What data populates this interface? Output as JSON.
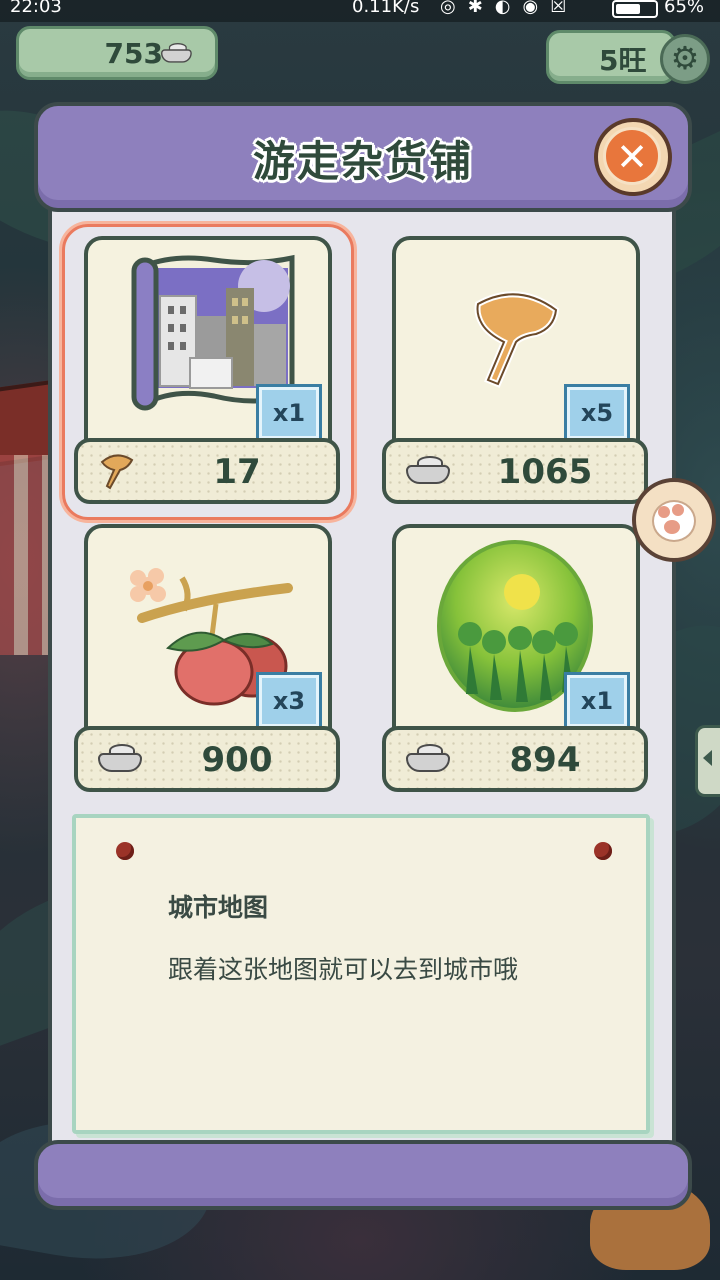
{
  "status_bar": {
    "time": "22:03",
    "network_speed": "0.11K/s",
    "battery": "65%"
  },
  "top_bar": {
    "currency_amount": "753",
    "currency_icon": "silver-ingot-icon",
    "level": "5旺",
    "settings_icon": "gear-icon"
  },
  "shop": {
    "title": "游走杂货铺",
    "close_icon": "close-icon",
    "items": [
      {
        "name": "城市地图",
        "art": "city-map-icon",
        "quantity": "x1",
        "price": "17",
        "price_icon": "ginkgo-leaf-icon",
        "selected": true
      },
      {
        "name": "",
        "art": "ginkgo-leaf-icon",
        "quantity": "x5",
        "price": "1065",
        "price_icon": "silver-ingot-icon",
        "selected": false
      },
      {
        "name": "",
        "art": "fruit-branch-icon",
        "quantity": "x3",
        "price": "900",
        "price_icon": "silver-ingot-icon",
        "selected": false
      },
      {
        "name": "",
        "art": "green-orb-icon",
        "quantity": "x1",
        "price": "894",
        "price_icon": "silver-ingot-icon",
        "selected": false
      }
    ],
    "description": {
      "item_name": "城市地图",
      "text": "跟着这张地图就可以去到城市哦"
    }
  },
  "side": {
    "paw_icon": "paw-icon",
    "drawer_icon": "chevron-left-icon"
  },
  "colors": {
    "header_purple": "#8e80bd",
    "panel_bg": "#e6e5ec",
    "card_bg": "#f5f2df",
    "outline": "#3f5448",
    "qty_badge": "#9fd0ea",
    "selection": "#ea7a5e",
    "close_orange": "#e8763c"
  }
}
